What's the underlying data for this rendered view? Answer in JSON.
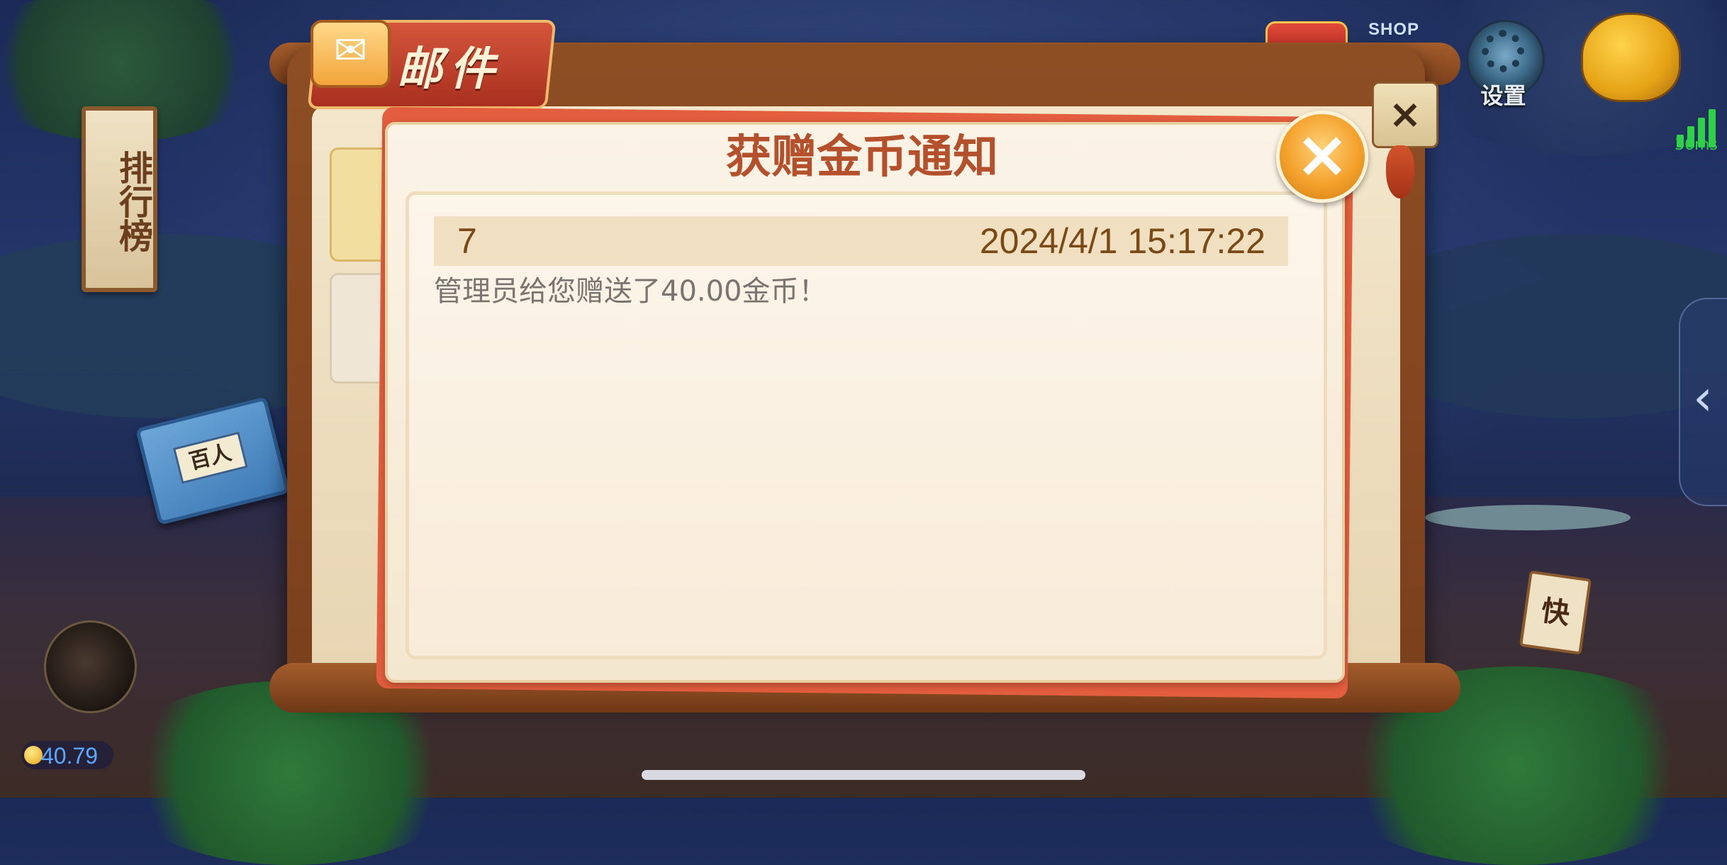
{
  "background": {
    "ranking_sign": "排行榜",
    "book_label": "百人",
    "quick_tag": "快",
    "coin_balance": "40.79",
    "shop_label": "SHOP",
    "settings_label": "设置",
    "ping": "36ms",
    "signal_bars": 4
  },
  "mail_board": {
    "title": "邮件",
    "close_label": "×"
  },
  "dialog": {
    "title": "获赠金币通知",
    "close_label": "×",
    "message": {
      "id": "7",
      "date": "2024/4/1 15:17:22",
      "body": "管理员给您赠送了40.00金币！"
    }
  },
  "colors": {
    "dialog_title": "#b4502c",
    "row_text": "#7a4a16",
    "message_text": "#7a7470",
    "close_button": "#f4a12c",
    "dialog_border_accent": "#e25e3e",
    "ping_green": "#2fd146"
  },
  "icons": [
    "envelope-icon",
    "close-icon",
    "gift-icon",
    "shop-icon",
    "gear-icon",
    "submarine-icon",
    "signal-icon",
    "chevron-left-icon",
    "coin-icon"
  ]
}
